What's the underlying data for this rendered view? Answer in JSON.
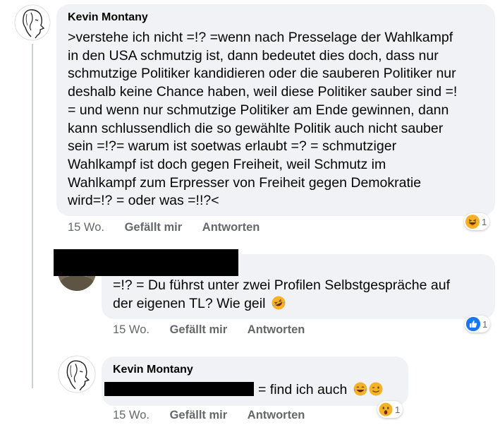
{
  "comment1": {
    "author": "Kevin Montany",
    "lines": [
      ">verstehe ich nicht =!? =wenn nach Presselage der Wahlkampf",
      "in den USA schmutzig ist, dann bedeutet dies doch, dass nur",
      "schmutzige Politiker kandidieren oder die sauberen Politiker nur",
      "deshalb keine Chance haben, weil diese Politiker sauber sind =!",
      "= und wenn nur schmutzige Politiker am Ende gewinnen, dann",
      "kann schlussendlich die so gewählte Politik  auch nicht sauber",
      "sein =!?= warum ist  soetwas erlaubt =? = schmutziger",
      "Wahlkampf ist doch gegen Freiheit, weil  Schmutz im",
      "Wahlkampf zum  Erpresser von Freiheit gegen  Demokratie",
      "wird=!? = oder was =!!?<"
    ],
    "time": "15 Wo.",
    "like": "Gefällt mir",
    "reply": "Antworten",
    "reaction": {
      "icon": "laughing-emoji",
      "count": "1"
    }
  },
  "comment2": {
    "lines": [
      "=!? = Du führst unter zwei Profilen Selbstgespräche auf",
      "der eigenen TL? Wie geil"
    ],
    "time": "15 Wo.",
    "like": "Gefällt mir",
    "reply": "Antworten",
    "reaction": {
      "icon": "like-thumb-icon",
      "count": "1",
      "color": "#1877f2"
    }
  },
  "comment3": {
    "author": "Kevin Montany",
    "text": "= find ich auch",
    "time": "15 Wo.",
    "like": "Gefällt mir",
    "reply": "Antworten",
    "reaction": {
      "icon": "wow-emoji",
      "count": "1"
    }
  },
  "colors": {
    "bubble": "#f0f2f5",
    "meta": "#65676b",
    "text": "#050505",
    "like_blue": "#1877f2",
    "emoji_yellow": "#f7b125"
  }
}
